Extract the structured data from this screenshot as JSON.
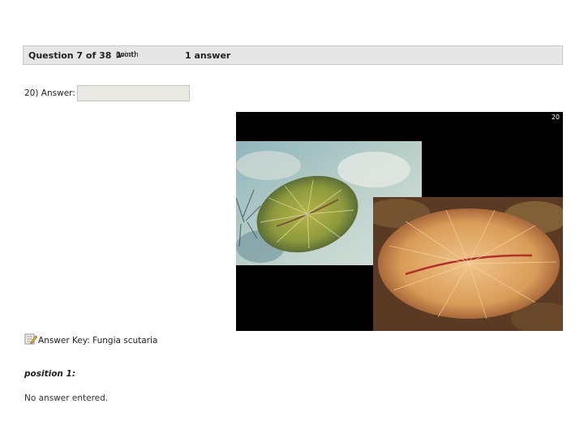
{
  "question_bar": {
    "counter": "Question 7 of 38",
    "worth_prefix": "(worth",
    "worth_value": "1",
    "worth_suffix": "point)",
    "answers": "1 answer"
  },
  "answer": {
    "label": "20) Answer:",
    "value": ""
  },
  "figure": {
    "number": "20",
    "photos": [
      "fungia-coral-green",
      "fungia-coral-orange"
    ]
  },
  "answer_key": {
    "icon": "edit-note-icon",
    "label": "Answer Key: Fungia scutaria"
  },
  "position": {
    "label": "position 1:",
    "status": "No answer entered."
  },
  "colors": {
    "bar_bg": "#e6e6e6",
    "input_bg": "#ebe9e3",
    "figure_bg": "#000000"
  }
}
